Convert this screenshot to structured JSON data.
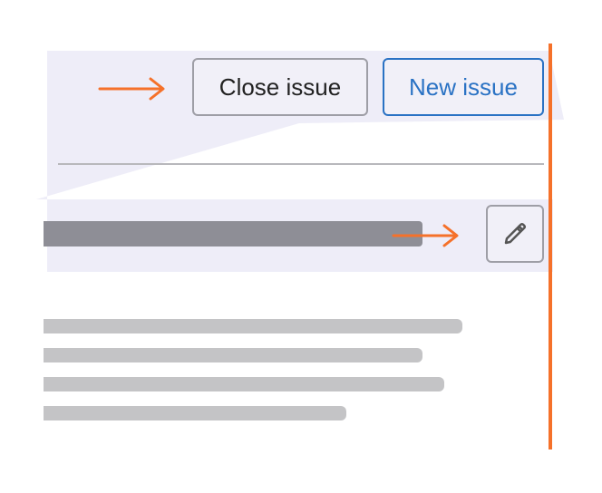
{
  "buttons": {
    "close_issue_label": "Close issue",
    "new_issue_label": "New issue",
    "edit_icon": "pencil-icon"
  },
  "colors": {
    "accent_arrow": "#f5712a",
    "highlight_band": "#eeedf8",
    "primary_button_text": "#2a72c4",
    "secondary_button_border": "#9e9ea6",
    "title_placeholder": "#8e8e96",
    "text_placeholder": "#c4c4c6"
  },
  "annotations": {
    "arrow_count": 2,
    "vertical_guide": "right-edge"
  }
}
